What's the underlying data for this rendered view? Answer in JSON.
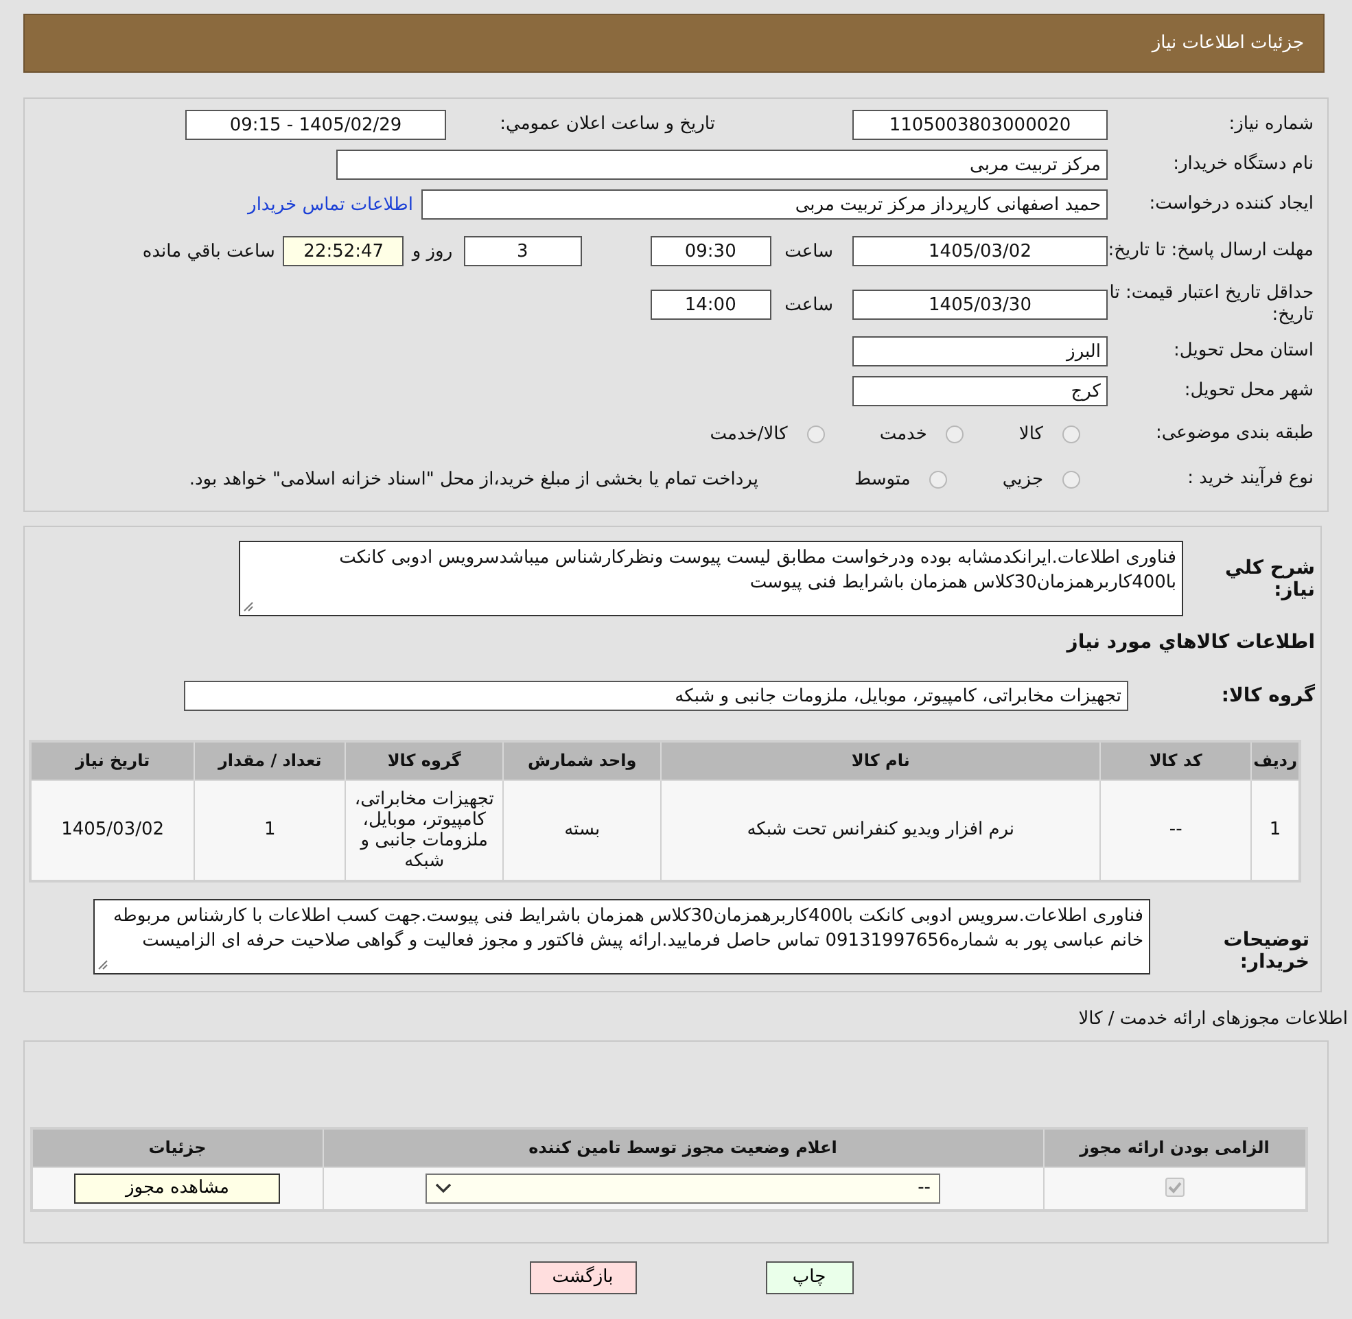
{
  "header": {
    "title": "جزئیات اطلاعات نیاز"
  },
  "need_info": {
    "need_number": {
      "label": "شماره نیاز:",
      "value": "1105003803000020"
    },
    "announce_date": {
      "label": "تاریخ و ساعت اعلان عمومي:",
      "value": "1405/02/29 - 09:15"
    },
    "buyer_org": {
      "label": "نام دستگاه خریدار:",
      "value": "مرکز تربیت مربی"
    },
    "requester": {
      "label": "ایجاد کننده درخواست:",
      "value": "حمید اصفهانی کارپرداز مرکز تربیت مربی",
      "link": "اطلاعات تماس خریدار"
    },
    "response_deadline": {
      "label": "مهلت ارسال پاسخ: تا تاریخ:",
      "date": "1405/03/02",
      "time_label": "ساعت",
      "time": "09:30",
      "days": "3",
      "days_label": "روز و",
      "remaining": "22:52:47",
      "remaining_label": "ساعت باقي مانده"
    },
    "price_validity": {
      "label": "حداقل تاریخ اعتبار قیمت: تا تاریخ:",
      "date": "1405/03/30",
      "time_label": "ساعت",
      "time": "14:00"
    },
    "province": {
      "label": "استان محل تحویل:",
      "value": "البرز"
    },
    "city": {
      "label": "شهر محل تحویل:",
      "value": "کرج"
    },
    "category": {
      "label": "طبقه بندی موضوعی:",
      "options": [
        {
          "label": "کالا",
          "selected": false
        },
        {
          "label": "خدمت",
          "selected": false
        },
        {
          "label": "کالا/خدمت",
          "selected": false
        }
      ]
    },
    "purchase_type": {
      "label": "نوع فرآیند خرید :",
      "options": [
        {
          "label": "جزيي",
          "selected": false
        },
        {
          "label": "متوسط",
          "selected": false
        }
      ],
      "note": "پرداخت تمام یا بخشی از مبلغ خرید،از محل \"اسناد خزانه اسلامی\" خواهد بود."
    }
  },
  "goods": {
    "description": {
      "label": "شرح کلي نياز:",
      "value": "فناوری اطلاعات.ایرانکدمشابه بوده ودرخواست مطابق لیست پیوست ونظرکارشناس میباشدسرویس ادوبی کانکت با400کاربرهمزمان30کلاس همزمان باشرایط فنی پیوست"
    },
    "subtitle": "اطلاعات کالاهاي مورد نياز",
    "group": {
      "label": "گروه کالا:",
      "value": "تجهیزات مخابراتی، کامپیوتر، موبایل، ملزومات جانبی و شبکه"
    },
    "table": {
      "columns": [
        "ردیف",
        "کد کالا",
        "نام کالا",
        "واحد شمارش",
        "گروه کالا",
        "تعداد / مقدار",
        "تاریخ نیاز"
      ],
      "rows": [
        [
          "1",
          "--",
          "نرم افزار ویدیو کنفرانس تحت شبکه",
          "بسته",
          "تجهیزات مخابراتی، کامپیوتر، موبایل، ملزومات جانبی و شبکه",
          "1",
          "1405/03/02"
        ]
      ]
    },
    "buyer_notes": {
      "label": "توضیحات خریدار:",
      "value": "فناوری اطلاعات.سرویس ادوبی کانکت با400کاربرهمزمان30کلاس همزمان باشرایط فنی پیوست.جهت کسب اطلاعات با کارشناس مربوطه خانم عباسی پور به شماره09131997656 تماس حاصل فرمایید.ارائه پیش فاکتور و مجوز فعالیت و گواهی صلاحیت حرفه ای الزامیست"
    }
  },
  "licenses": {
    "title": "اطلاعات مجوزهای ارائه خدمت / کالا",
    "columns": [
      "الزامی بودن ارائه مجوز",
      "اعلام وضعیت مجوز توسط تامین کننده",
      "جزئیات"
    ],
    "rows": [
      {
        "required": true,
        "status": "--",
        "details_button": "مشاهده مجوز"
      }
    ]
  },
  "buttons": [
    {
      "label": "چاپ",
      "kind": "print"
    },
    {
      "label": "بازگشت",
      "kind": "back"
    }
  ]
}
